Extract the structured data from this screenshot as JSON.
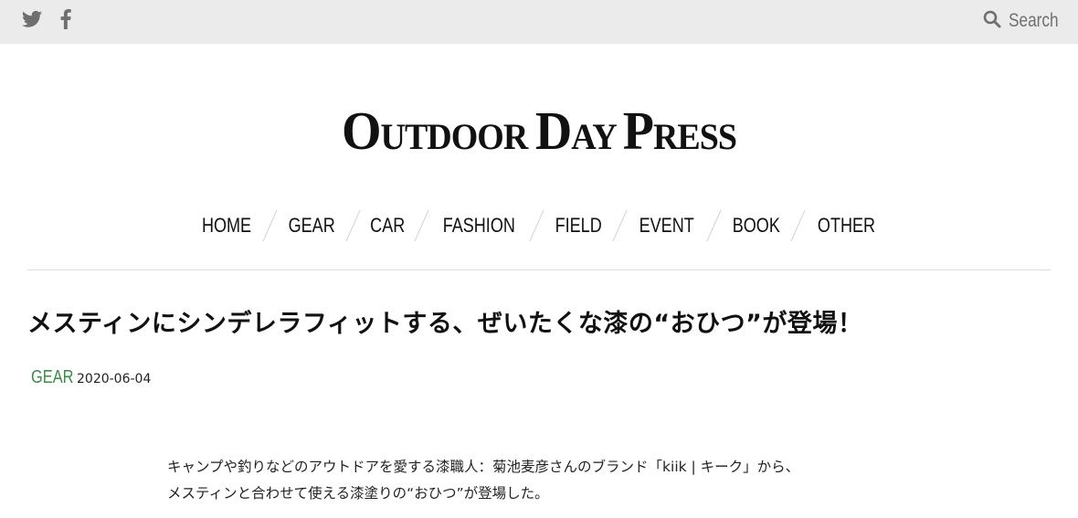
{
  "topbar": {
    "social": [
      {
        "icon": "twitter-icon"
      },
      {
        "icon": "facebook-icon"
      }
    ],
    "search": {
      "icon": "search-icon",
      "label": "Search"
    }
  },
  "logo": {
    "first": "O",
    "rest1": "UTDOOR ",
    "second": "D",
    "rest2": "AY ",
    "third": "P",
    "rest3": "RESS"
  },
  "nav": {
    "items": [
      "HOME",
      "GEAR",
      "CAR",
      "FASHION",
      "FIELD",
      "EVENT",
      "BOOK",
      "OTHER"
    ]
  },
  "article": {
    "title": "メスティンにシンデレラフィットする、ぜいたくな漆の“おひつ”が登場！",
    "category": "GEAR",
    "date": "2020-06-04",
    "paragraph_lines": [
      "キャンプや釣りなどのアウトドアを愛する漆職人：菊池麦彦さんのブランド「kiik | キーク」から、",
      "メスティンと合わせて使える漆塗りの“おひつ”が登場した。"
    ]
  },
  "colors": {
    "topbar_bg": "#ebebeb",
    "category_green": "#3c8a4a",
    "icon_gray": "#6f6f6f"
  }
}
